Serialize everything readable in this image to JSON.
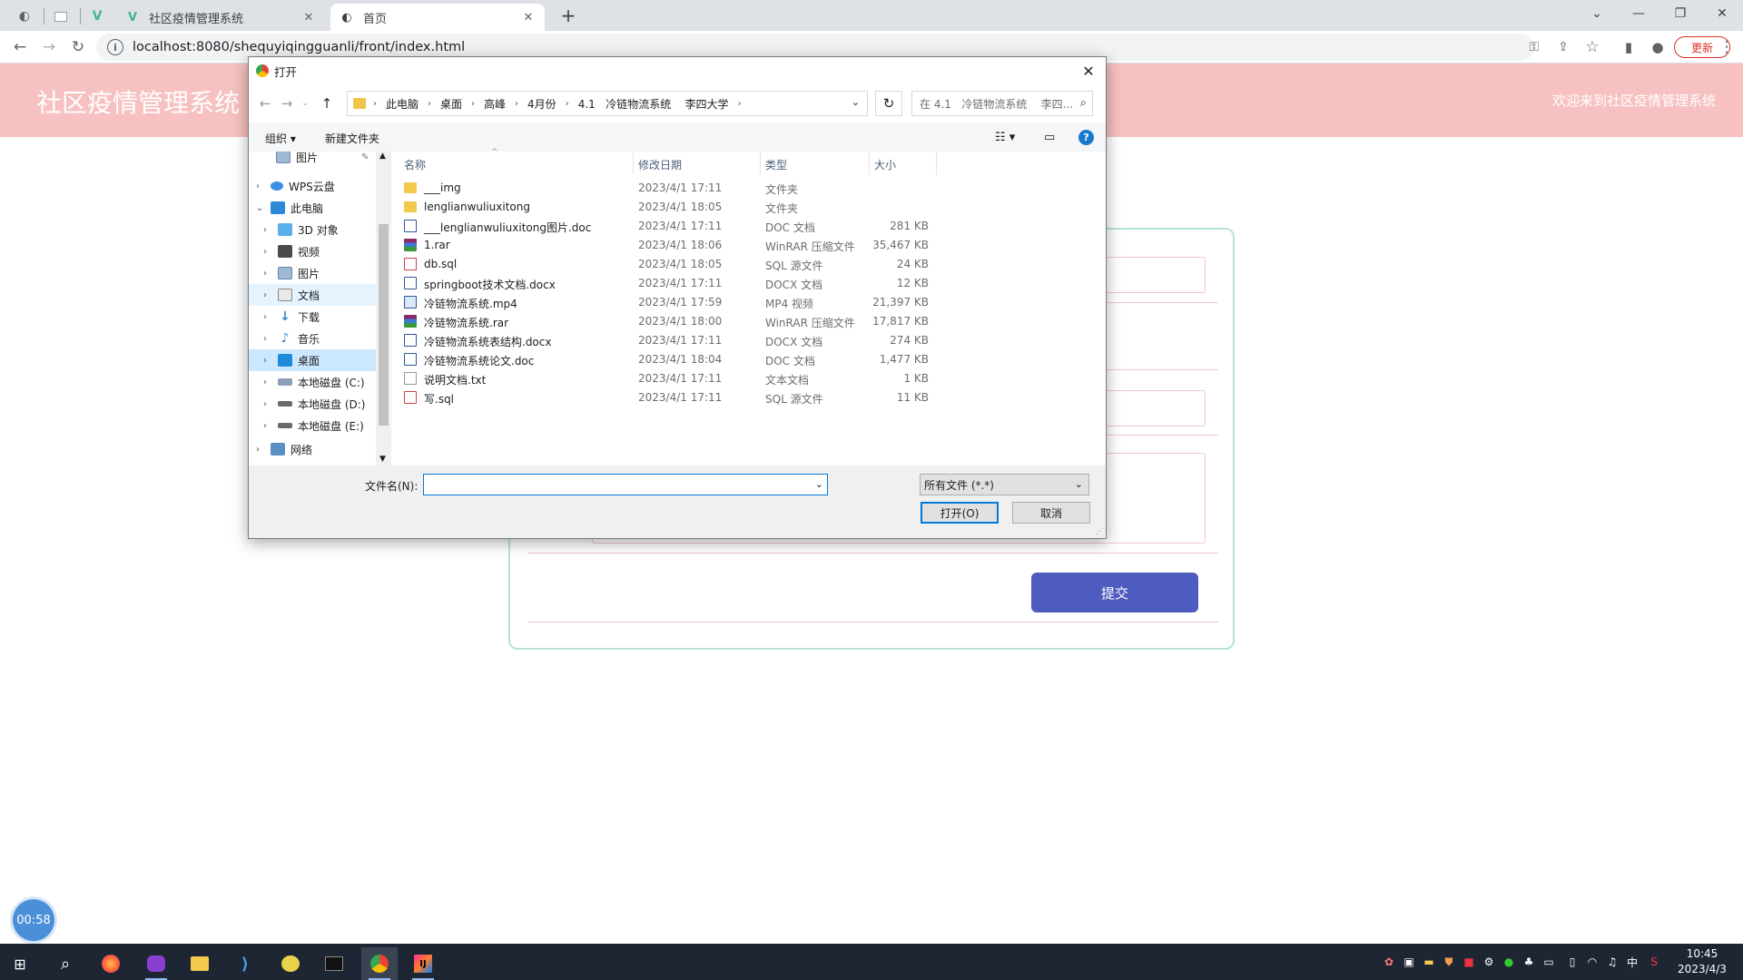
{
  "browser": {
    "tabs": [
      {
        "title": "社区疫情管理系统"
      },
      {
        "title": "首页"
      }
    ],
    "new_tab": "+",
    "url": "localhost:8080/shequyiqingguanli/front/index.html",
    "update_label": "更新"
  },
  "site": {
    "title": "社区疫情管理系统",
    "welcome": "欢迎来到社区疫情管理系统",
    "submit_label": "提交"
  },
  "timer": "00:58",
  "dialog": {
    "title": "打开",
    "breadcrumb": [
      "此电脑",
      "桌面",
      "高峰",
      "4月份",
      "4.1   冷链物流系统    李四大学"
    ],
    "search_placeholder": "在 4.1   冷链物流系统    李四...",
    "toolbar": {
      "organize": "组织 ▾",
      "new_folder": "新建文件夹"
    },
    "nav_tree": [
      {
        "label": "图片",
        "icon": "pictures-icon",
        "level": 1,
        "pinned": true
      },
      {
        "label": "WPS云盘",
        "icon": "cloud-icon",
        "level": 0
      },
      {
        "label": "此电脑",
        "icon": "computer-icon",
        "level": 0,
        "expanded": true
      },
      {
        "label": "3D 对象",
        "icon": "3d-objects-icon",
        "level": 1
      },
      {
        "label": "视频",
        "icon": "videos-icon",
        "level": 1
      },
      {
        "label": "图片",
        "icon": "pictures-icon",
        "level": 1
      },
      {
        "label": "文档",
        "icon": "documents-icon",
        "level": 1,
        "hover": true
      },
      {
        "label": "下载",
        "icon": "downloads-icon",
        "level": 1
      },
      {
        "label": "音乐",
        "icon": "music-icon",
        "level": 1
      },
      {
        "label": "桌面",
        "icon": "desktop-icon",
        "level": 1,
        "selected": true
      },
      {
        "label": "本地磁盘 (C:)",
        "icon": "drive-icon",
        "level": 1
      },
      {
        "label": "本地磁盘 (D:)",
        "icon": "drive-icon",
        "level": 1
      },
      {
        "label": "本地磁盘 (E:)",
        "icon": "drive-icon",
        "level": 1
      },
      {
        "label": "网络",
        "icon": "network-icon",
        "level": 0
      }
    ],
    "columns": [
      "名称",
      "修改日期",
      "类型",
      "大小"
    ],
    "files": [
      {
        "name": "___img",
        "date": "2023/4/1 17:11",
        "type": "文件夹",
        "size": "",
        "icon": "folder-icon"
      },
      {
        "name": "lenglianwuliuxitong",
        "date": "2023/4/1 18:05",
        "type": "文件夹",
        "size": "",
        "icon": "folder-icon"
      },
      {
        "name": "___lenglianwuliuxitong图片.doc",
        "date": "2023/4/1 17:11",
        "type": "DOC 文档",
        "size": "281 KB",
        "icon": "word-icon"
      },
      {
        "name": "1.rar",
        "date": "2023/4/1 18:06",
        "type": "WinRAR 压缩文件",
        "size": "35,467 KB",
        "icon": "rar-icon"
      },
      {
        "name": "db.sql",
        "date": "2023/4/1 18:05",
        "type": "SQL 源文件",
        "size": "24 KB",
        "icon": "sql-icon"
      },
      {
        "name": "springboot技术文档.docx",
        "date": "2023/4/1 17:11",
        "type": "DOCX 文档",
        "size": "12 KB",
        "icon": "word-icon"
      },
      {
        "name": "冷链物流系统.mp4",
        "date": "2023/4/1 17:59",
        "type": "MP4 视频",
        "size": "21,397 KB",
        "icon": "video-file-icon"
      },
      {
        "name": "冷链物流系统.rar",
        "date": "2023/4/1 18:00",
        "type": "WinRAR 压缩文件",
        "size": "17,817 KB",
        "icon": "rar-icon"
      },
      {
        "name": "冷链物流系统表结构.docx",
        "date": "2023/4/1 17:11",
        "type": "DOCX 文档",
        "size": "274 KB",
        "icon": "word-icon"
      },
      {
        "name": "冷链物流系统论文.doc",
        "date": "2023/4/1 18:04",
        "type": "DOC 文档",
        "size": "1,477 KB",
        "icon": "word-icon"
      },
      {
        "name": "说明文档.txt",
        "date": "2023/4/1 17:11",
        "type": "文本文档",
        "size": "1 KB",
        "icon": "text-file-icon"
      },
      {
        "name": "写.sql",
        "date": "2023/4/1 17:11",
        "type": "SQL 源文件",
        "size": "11 KB",
        "icon": "sql-icon"
      }
    ],
    "filename_label": "文件名(N):",
    "filename_value": "",
    "filetype": "所有文件 (*.*)",
    "open_label": "打开(O)",
    "cancel_label": "取消"
  },
  "taskbar": {
    "clock_time": "10:45",
    "clock_date": "2023/4/3",
    "ime": "中"
  },
  "colors": {
    "header_bg": "#f7c1c1",
    "submit_bg": "#4e5bbf",
    "card_border": "#b7e4d0",
    "selection": "#cce8ff",
    "taskbar": "#1f2633"
  }
}
